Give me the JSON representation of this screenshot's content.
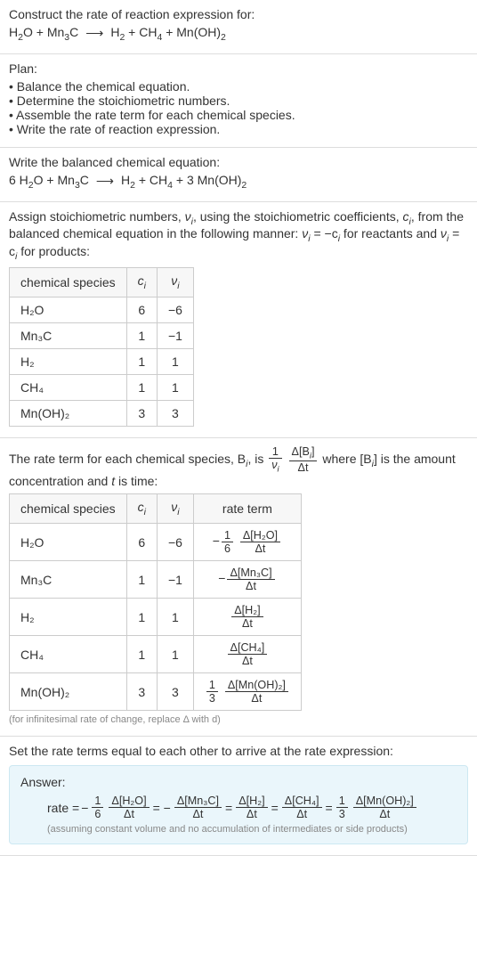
{
  "s1": {
    "heading": "Construct the rate of reaction expression for:",
    "rx": {
      "lhs1": "H",
      "lhs1s": "2",
      "lhs1b": "O + Mn",
      "lhs1s2": "3",
      "lhs1c": "C",
      "arrow": "⟶",
      "rhs": "H",
      "rhss": "2",
      "rhsb": " + CH",
      "rhss2": "4",
      "rhsc": " + Mn(OH)",
      "rhss3": "2"
    }
  },
  "s2": {
    "heading": "Plan:",
    "items": [
      "Balance the chemical equation.",
      "Determine the stoichiometric numbers.",
      "Assemble the rate term for each chemical species.",
      "Write the rate of reaction expression."
    ]
  },
  "s3": {
    "heading": "Write the balanced chemical equation:",
    "pre": "6 H",
    "s1": "2",
    "mid1": "O + Mn",
    "s2": "3",
    "mid2": "C",
    "arrow": "⟶",
    "post": "H",
    "s3": "2",
    "mid3": " + CH",
    "s4": "4",
    "mid4": " + 3 Mn(OH)",
    "s5": "2"
  },
  "s4": {
    "intro1": "Assign stoichiometric numbers, ",
    "nu": "ν",
    "sub_i": "i",
    "intro2": ", using the stoichiometric coefficients, ",
    "c": "c",
    "intro3": ", from the balanced chemical equation in the following manner: ",
    "eq1": "ν",
    "eq1s": "i",
    "eq2": " = −c",
    "eq2s": "i",
    "intro4": " for reactants and ",
    "eq3": "ν",
    "eq3s": "i",
    "eq4": " = c",
    "eq4s": "i",
    "intro5": " for products:",
    "head": {
      "a": "chemical species",
      "b": "c",
      "bs": "i",
      "c": "ν",
      "cs": "i"
    },
    "rows": [
      {
        "sp": "H₂O",
        "c": "6",
        "v": "−6"
      },
      {
        "sp": "Mn₃C",
        "c": "1",
        "v": "−1"
      },
      {
        "sp": "H₂",
        "c": "1",
        "v": "1"
      },
      {
        "sp": "CH₄",
        "c": "1",
        "v": "1"
      },
      {
        "sp": "Mn(OH)₂",
        "c": "3",
        "v": "3"
      }
    ]
  },
  "s5": {
    "intro1": "The rate term for each chemical species, B",
    "sub_i": "i",
    "intro2": ", is ",
    "frac1n": "1",
    "frac1d": "ν",
    "frac1ds": "i",
    "frac2n": "Δ[B",
    "frac2ns": "i",
    "frac2nb": "]",
    "frac2d": "Δt",
    "intro3": " where [B",
    "intro3s": "i",
    "intro4": "] is the amount concentration and ",
    "tvar": "t",
    "intro5": " is time:",
    "head": {
      "a": "chemical species",
      "b": "c",
      "bs": "i",
      "c": "ν",
      "cs": "i",
      "d": "rate term"
    },
    "rows": [
      {
        "sp": "H₂O",
        "c": "6",
        "v": "−6",
        "neg": "−",
        "f1n": "1",
        "f1d": "6",
        "f2n": "Δ[H₂O]",
        "f2d": "Δt"
      },
      {
        "sp": "Mn₃C",
        "c": "1",
        "v": "−1",
        "neg": "−",
        "f1n": "",
        "f1d": "",
        "f2n": "Δ[Mn₃C]",
        "f2d": "Δt"
      },
      {
        "sp": "H₂",
        "c": "1",
        "v": "1",
        "neg": "",
        "f1n": "",
        "f1d": "",
        "f2n": "Δ[H₂]",
        "f2d": "Δt"
      },
      {
        "sp": "CH₄",
        "c": "1",
        "v": "1",
        "neg": "",
        "f1n": "",
        "f1d": "",
        "f2n": "Δ[CH₄]",
        "f2d": "Δt"
      },
      {
        "sp": "Mn(OH)₂",
        "c": "3",
        "v": "3",
        "neg": "",
        "f1n": "1",
        "f1d": "3",
        "f2n": "Δ[Mn(OH)₂]",
        "f2d": "Δt"
      }
    ],
    "note": "(for infinitesimal rate of change, replace Δ with d)"
  },
  "s6": {
    "heading": "Set the rate terms equal to each other to arrive at the rate expression:"
  },
  "answer": {
    "label": "Answer:",
    "rate": "rate = ",
    "terms": [
      {
        "neg": "−",
        "f1n": "1",
        "f1d": "6",
        "f2n": "Δ[H₂O]",
        "f2d": "Δt"
      },
      {
        "neg": "= −",
        "f1n": "",
        "f1d": "",
        "f2n": "Δ[Mn₃C]",
        "f2d": "Δt"
      },
      {
        "neg": "= ",
        "f1n": "",
        "f1d": "",
        "f2n": "Δ[H₂]",
        "f2d": "Δt"
      },
      {
        "neg": "= ",
        "f1n": "",
        "f1d": "",
        "f2n": "Δ[CH₄]",
        "f2d": "Δt"
      },
      {
        "neg": "= ",
        "f1n": "1",
        "f1d": "3",
        "f2n": "Δ[Mn(OH)₂]",
        "f2d": "Δt"
      }
    ],
    "note": "(assuming constant volume and no accumulation of intermediates or side products)"
  }
}
